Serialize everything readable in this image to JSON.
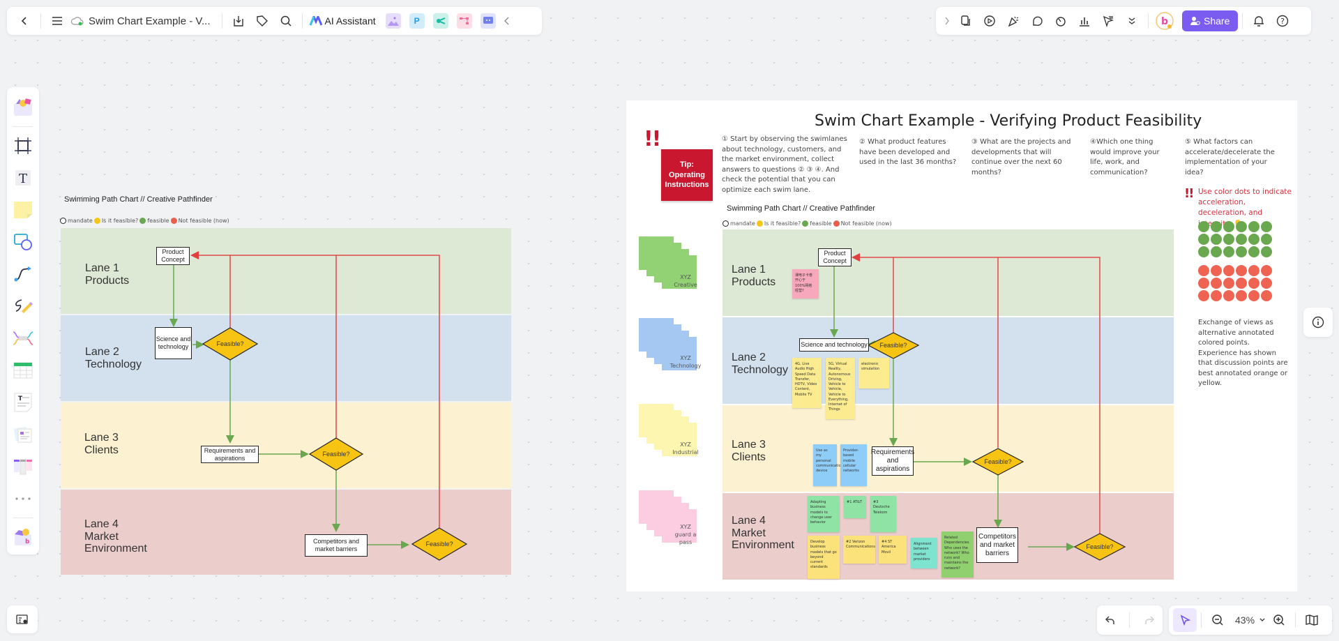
{
  "toolbar_left": {
    "back_icon": "chevron-left-icon",
    "menu_icon": "hamburger-icon",
    "cloud_icon": "cloud-synced-icon",
    "doc_title": "Swim Chart Example - V...",
    "download_icon": "download-icon",
    "tag_icon": "tag-icon",
    "search_icon": "search-icon",
    "ai_label": "AI Assistant",
    "apps": [
      "image-generator",
      "presentation",
      "mindmap",
      "flowchart",
      "chat"
    ],
    "collapse_icon": "chevron-left-icon"
  },
  "toolbar_right": {
    "tools": [
      "expand",
      "cards",
      "present",
      "celebrate",
      "comment",
      "timer",
      "chart",
      "laser-pointer",
      "more"
    ],
    "share_label": "Share",
    "notifications_icon": "bell-icon",
    "help_icon": "question-icon"
  },
  "left_sidebar": {
    "items": [
      "templates",
      "frame",
      "text",
      "sticky-note",
      "shapes",
      "connector",
      "pen",
      "mindmap",
      "table",
      "document",
      "cards",
      "kanban",
      "more",
      "plugins"
    ]
  },
  "bottom": {
    "zoom_value": "43%",
    "undo_icon": "undo-icon",
    "redo_icon": "redo-icon",
    "select_icon": "cursor-icon",
    "zoom_out_icon": "zoom-out-icon",
    "zoom_in_icon": "zoom-in-icon",
    "map_icon": "book-map-icon"
  },
  "left_chart": {
    "title": "Swimming Path Chart // Creative Pathfinder",
    "legend": [
      {
        "label": "mandate",
        "color": "#ffffff"
      },
      {
        "label": "Is it feasible?",
        "color": "#f5c518"
      },
      {
        "label": "feasible",
        "color": "#6aa84f"
      },
      {
        "label": "Not feasible (now)",
        "color": "#e8604c"
      }
    ],
    "lanes": [
      {
        "line1": "Lane 1",
        "line2": "Products",
        "line3": "",
        "color": "#dde8d5"
      },
      {
        "line1": "Lane 2",
        "line2": "Technology",
        "line3": "",
        "color": "#d3e1ef"
      },
      {
        "line1": "Lane 3",
        "line2": "Clients",
        "line3": "",
        "color": "#fcf1d0"
      },
      {
        "line1": "Lane 4",
        "line2": "Market",
        "line3": "Environment",
        "color": "#ebcdcc"
      }
    ],
    "nodes": {
      "product_concept": "Product Concept",
      "science": "Science and technology",
      "requirements": "Requirements and aspirations",
      "competitors": "Competitors and market barriers",
      "feasible": "Feasible?"
    }
  },
  "board": {
    "title": "Swim Chart Example - Verifying Product Feasibility",
    "tip": "Tip: Operating Instructions",
    "bang": "!!",
    "questions": [
      "① Start by observing the swimlanes about technology, customers, and the market environment, collect answers to questions ② ③ ④. And check the potential that you can optimize each swim lane.",
      "② What product features have been developed and used in the last 36 months?",
      "③ What are the projects and developments that will continue over the next 60 months?",
      "④Which one thing would improve your life, work, and communication?",
      "⑤ What factors can accelerate/decelerate the implementation of your idea?"
    ],
    "color_hint": "Use color dots to indicate acceleration, deceleration, and intensity:",
    "pointer_emoji": "👇",
    "dots": {
      "green_count": 18,
      "red_count": 18,
      "green": "#6aa84f",
      "red": "#ee6352"
    },
    "exchange_note": "Exchange of views as alternative annotated colored points. Experience has shown that discussion points are best annotated orange or yellow.",
    "stacks": [
      {
        "label": "XYZ Creative",
        "color": "#93d274"
      },
      {
        "label": "XYZ Technology",
        "color": "#a4c8f2"
      },
      {
        "label": "XYZ Industrial",
        "color": "#fdf6b0"
      },
      {
        "label": "XYZ guard a pass",
        "color": "#fccde1"
      }
    ],
    "chart_title": "Swimming Path Chart // Creative Pathfinder",
    "notes": {
      "lane1_pink": "课电子卡卷 开心于 100%网络 经营?",
      "tech_4g": "4G, Live Audio High Speed Data Transfer, HDTV, Video Content, Mobile TV",
      "tech_5g": "5G, Virtual Reality, Autonomous Driving, Vehicle to Vehicle, Vehicle to Everything, Internet of Things",
      "tech_sim": "electronic simulation",
      "client_use": "Use as my personal communication device",
      "client_provider": "Provider-based mobile cellular networks",
      "m_adapting": "Adapting business models to change user behavior",
      "m_att": "#1 AT&T",
      "m_dt": "#3 Deutsche Telekom",
      "m_develop": "Develop business models that go beyond current standards",
      "m_verizon": "#2 Verizon Communications",
      "m_america": "#4 ST America Movil",
      "m_alignment": "Alignment between market providers",
      "m_related": "Related Dependencies Who uses the network? Who runs and maintains the network?"
    },
    "nodes": {
      "product_concept": "Product Concept",
      "science": "Science and technology",
      "requirements": "Requirements and aspirations",
      "competitors": "Competitors and market barriers",
      "feasible": "Feasible?"
    }
  }
}
